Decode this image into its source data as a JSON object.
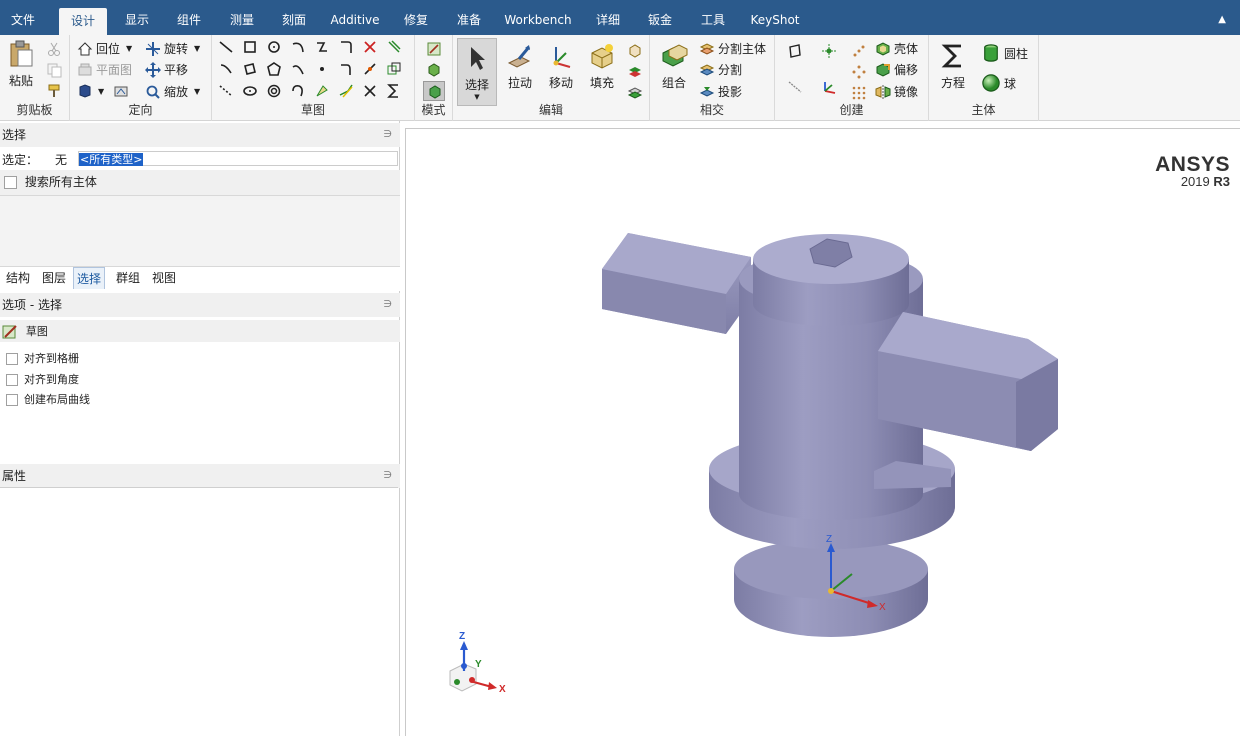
{
  "menu": {
    "tabs": [
      "文件",
      "设计",
      "显示",
      "组件",
      "测量",
      "刻面",
      "Additive",
      "修复",
      "准备",
      "Workbench",
      "详细",
      "钣金",
      "工具",
      "KeyShot"
    ],
    "active": "设计"
  },
  "ribbon": {
    "clipboard": {
      "title": "剪贴板",
      "paste": "粘贴"
    },
    "orient": {
      "title": "定向",
      "home": "回位",
      "rotate": "旋转",
      "plan": "平面图",
      "pan": "平移",
      "zoom": "缩放"
    },
    "sketch": {
      "title": "草图"
    },
    "mode": {
      "title": "模式"
    },
    "edit": {
      "title": "编辑",
      "select": "选择",
      "pull": "拉动",
      "move": "移动",
      "fill": "填充"
    },
    "intersect": {
      "title": "相交",
      "combine": "组合",
      "split_body": "分割主体",
      "split": "分割",
      "project": "投影"
    },
    "create": {
      "title": "创建",
      "shell": "壳体",
      "offset": "偏移",
      "mirror": "镜像"
    },
    "body": {
      "title": "主体",
      "equation": "方程",
      "cylinder": "圆柱",
      "sphere": "球"
    }
  },
  "panel": {
    "select_title": "选择",
    "selected_label": "选定：",
    "selected_value": "无",
    "filter": "<所有类型>",
    "search_all": "搜索所有主体",
    "tabs": [
      "结构",
      "图层",
      "选择",
      "群组",
      "视图"
    ],
    "active_tab": "选择",
    "options_title": "选项 - 选择",
    "sketch_label": "草图",
    "options": [
      "对齐到格栅",
      "对齐到角度",
      "创建布局曲线"
    ],
    "properties_title": "属性"
  },
  "viewport": {
    "brand": "ANSYS",
    "version": "2019",
    "release": "R3",
    "axis_labels": {
      "x": "X",
      "y": "Y",
      "z": "Z"
    },
    "model_color": "#8c8cb0"
  }
}
